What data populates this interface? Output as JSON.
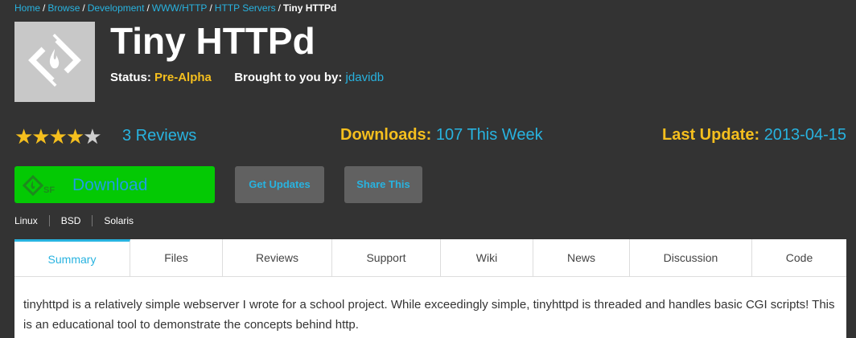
{
  "breadcrumb": {
    "items": [
      "Home",
      "Browse",
      "Development",
      "WWW/HTTP",
      "HTTP Servers"
    ],
    "current": "Tiny HTTPd",
    "separator": "/"
  },
  "project": {
    "logo_icon": "sourceforge-diamond-icon",
    "title": "Tiny HTTPd",
    "status_label": "Status:",
    "status_value": "Pre-Alpha",
    "author_label": "Brought to you by:",
    "author_value": "jdavidb"
  },
  "stats": {
    "rating": 4.5,
    "stars_glyph": "★★★★",
    "half_star_glyph": "★",
    "reviews_link": "3 Reviews",
    "downloads_label": "Downloads:",
    "downloads_value": "107 This Week",
    "last_update_label": "Last Update:",
    "last_update_value": "2013-04-15"
  },
  "actions": {
    "download_label": "Download",
    "get_updates_label": "Get Updates",
    "share_label": "Share This"
  },
  "platforms": [
    "Linux",
    "BSD",
    "Solaris"
  ],
  "tabs": [
    {
      "label": "Summary",
      "active": true
    },
    {
      "label": "Files"
    },
    {
      "label": "Reviews"
    },
    {
      "label": "Support"
    },
    {
      "label": "Wiki"
    },
    {
      "label": "News"
    },
    {
      "label": "Discussion"
    },
    {
      "label": "Code"
    }
  ],
  "summary_text": "tinyhttpd is a relatively simple webserver I wrote for a school project. While exceedingly simple, tinyhttpd is threaded and handles basic CGI scripts! This is an educational tool to demonstrate the concepts behind http.",
  "colors": {
    "background": "#333333",
    "accent_blue": "#28b3e0",
    "accent_yellow": "#f5bf1e",
    "download_green": "#04c904"
  }
}
